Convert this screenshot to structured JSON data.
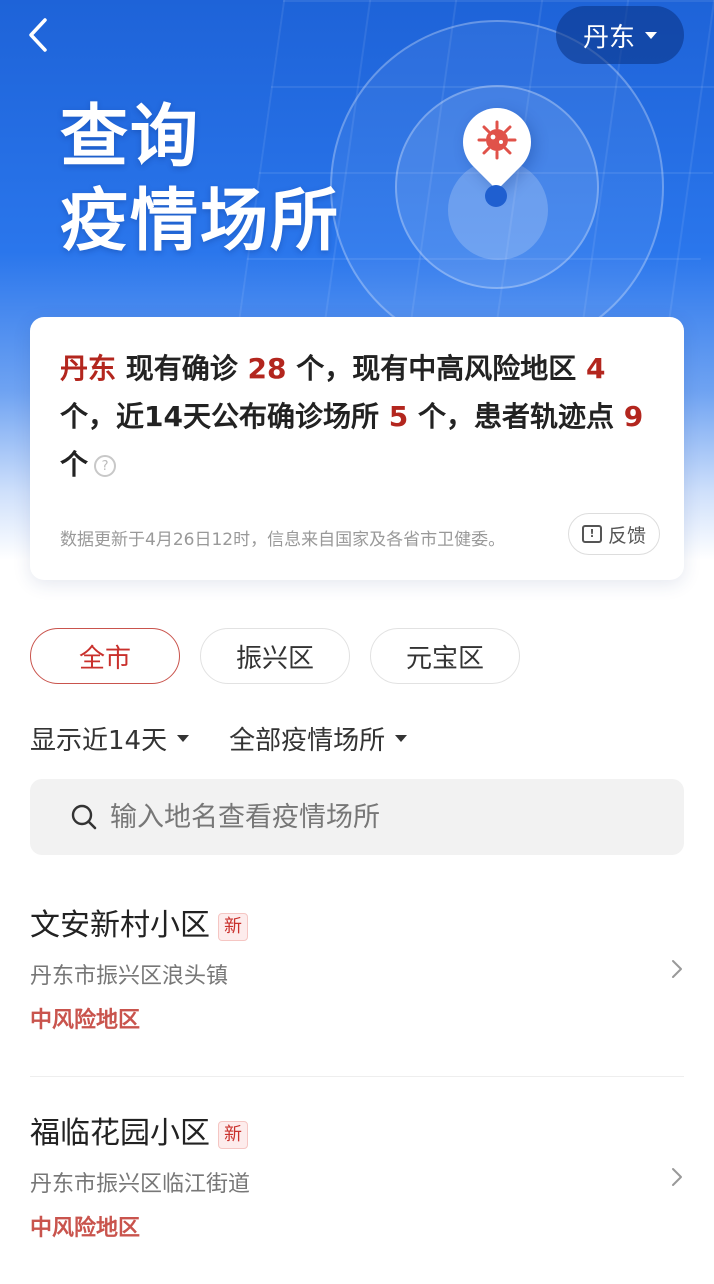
{
  "header": {
    "title_line1": "查询",
    "title_line2": "疫情场所",
    "city": "丹东"
  },
  "summary": {
    "city": "丹东",
    "part1": " 现有确诊 ",
    "confirmed": "28",
    "part2": " 个，现有中高风险地区 ",
    "risk_areas": "4",
    "part3": " 个，近14天公布确诊场所 ",
    "sites": "5",
    "part4": " 个，患者轨迹点 ",
    "track_points": "9",
    "part5": " 个",
    "help": "?",
    "update_info": "数据更新于4月26日12时，信息来自国家及各省市卫健委。",
    "feedback_label": "反馈",
    "feedback_icon_glyph": "!"
  },
  "district_tabs": [
    {
      "label": "全市"
    },
    {
      "label": "振兴区"
    },
    {
      "label": "元宝区"
    }
  ],
  "filters": {
    "period": "显示近14天",
    "type": "全部疫情场所"
  },
  "search": {
    "placeholder": "输入地名查看疫情场所"
  },
  "places": [
    {
      "name": "文安新村小区",
      "badge": "新",
      "address": "丹东市振兴区浪头镇",
      "risk": "中风险地区"
    },
    {
      "name": "福临花园小区",
      "badge": "新",
      "address": "丹东市振兴区临江街道",
      "risk": "中风险地区"
    }
  ],
  "colors": {
    "accent": "#c9302c",
    "hero_blue": "#1e63d8"
  }
}
